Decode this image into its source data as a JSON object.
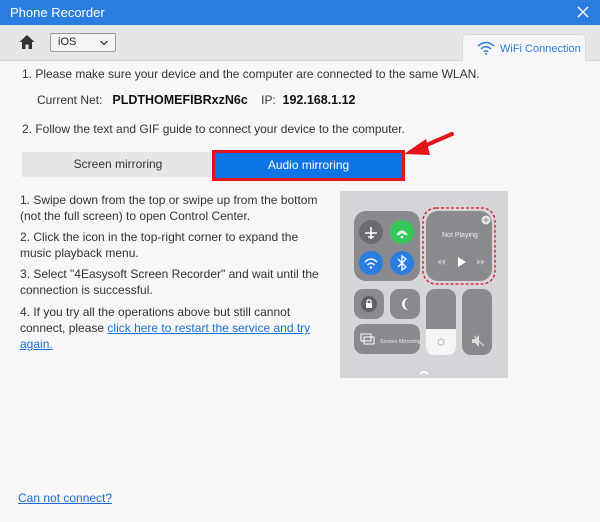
{
  "window": {
    "title": "Phone Recorder"
  },
  "toolbar": {
    "device_select": "iOS",
    "wifi_tab_label": "WiFi Connection"
  },
  "steps": {
    "step1": "1. Please make sure your device and the computer are connected to the same WLAN.",
    "current_net_label": "Current Net:",
    "current_net_value": "PLDTHOMEFIBRxzN6c",
    "ip_label": "IP:",
    "ip_value": "192.168.1.12",
    "step2": "2. Follow the text and GIF guide to connect your device to the computer."
  },
  "tabs": {
    "screen_mirroring": "Screen mirroring",
    "audio_mirroring": "Audio mirroring"
  },
  "instructions": {
    "i1": "1. Swipe down from the top or swipe up from the bottom (not the full screen) to open Control Center.",
    "i2": "2. Click the icon in the top-right corner to expand the music playback menu.",
    "i3": "3. Select \"4Easysoft Screen Recorder\" and wait until the connection is successful.",
    "i4_text": "4. If you try all the operations above but still cannot connect, please ",
    "i4_link": "click here to restart the service and try again."
  },
  "control_center": {
    "not_playing": "Not Playing",
    "screen_mirroring": "Screen Mirroring"
  },
  "footer": {
    "cannot_connect": "Can not connect?"
  },
  "colors": {
    "accent": "#2a7ee0",
    "active_tab": "#0d75e6",
    "highlight": "#e3121b"
  }
}
